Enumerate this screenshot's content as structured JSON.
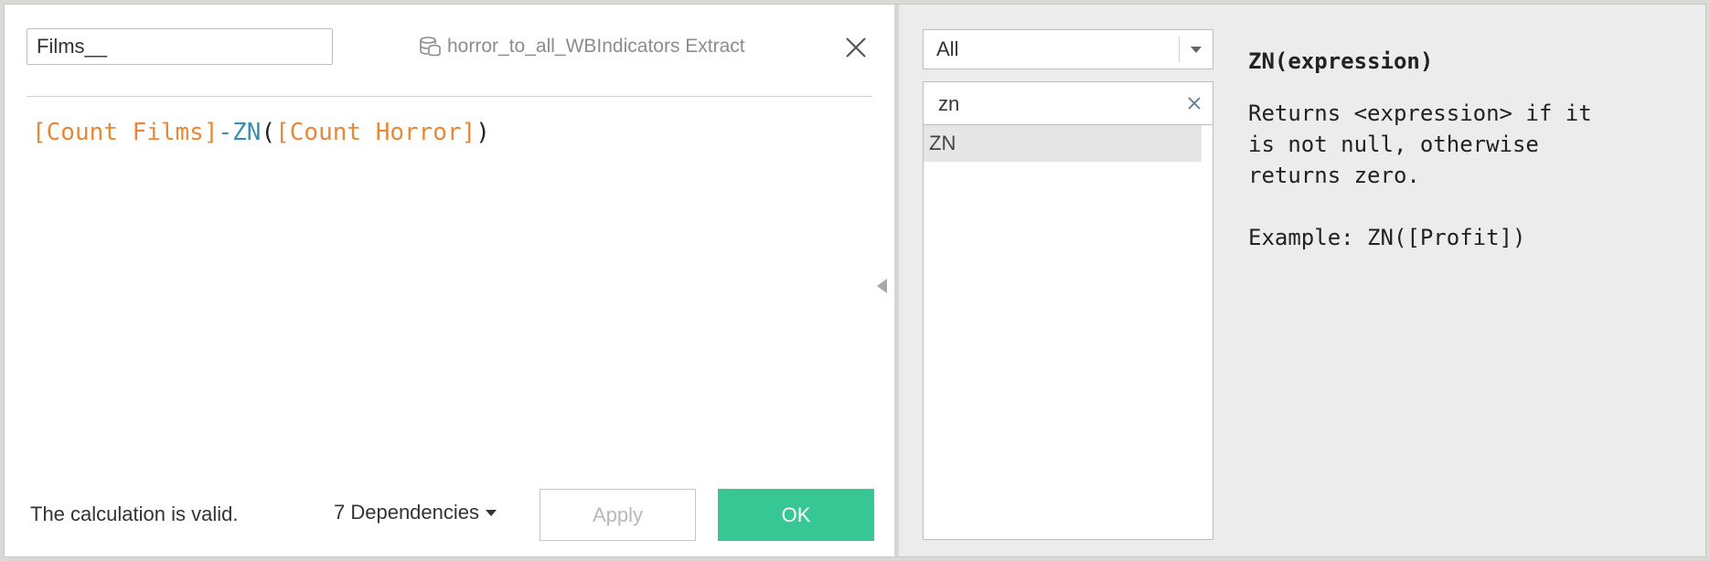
{
  "editor": {
    "calc_name": "Films__",
    "datasource": "horror_to_all_WBIndicators Extract",
    "formula": {
      "field1": "[Count Films]",
      "operator": "-",
      "func": "ZN",
      "open_paren": "(",
      "field2": "[Count Horror]",
      "close_paren": ")"
    },
    "status": "The calculation is valid.",
    "dependencies": "7 Dependencies",
    "apply_label": "Apply",
    "ok_label": "OK"
  },
  "functions": {
    "category": "All",
    "search": "zn",
    "items": [
      "ZN"
    ]
  },
  "help": {
    "title": "ZN(expression)",
    "description": "Returns <expression> if it\nis not null, otherwise\nreturns zero.",
    "example": "Example: ZN([Profit])"
  },
  "colors": {
    "ok": "#36c794",
    "field": "#e8883a",
    "function": "#3a8fb5"
  }
}
